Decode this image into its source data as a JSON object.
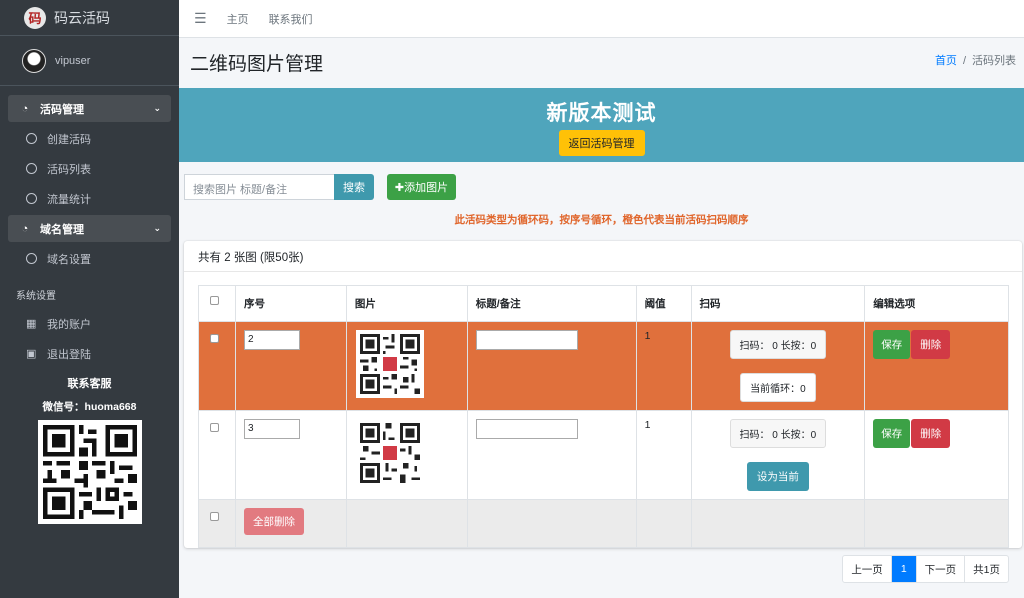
{
  "brand": {
    "logo_text": "码",
    "name": "码云活码"
  },
  "user": {
    "name": "vipuser"
  },
  "sidebar": {
    "groups": [
      {
        "label": "活码管理",
        "items": [
          "创建活码",
          "活码列表",
          "流量统计"
        ]
      },
      {
        "label": "域名管理",
        "items": [
          "域名设置"
        ]
      }
    ],
    "settings_header": "系统设置",
    "settings_items": [
      "我的账户",
      "退出登陆"
    ],
    "contact_title": "联系客服",
    "contact_wechat": "微信号：huoma668"
  },
  "topnav": {
    "items": [
      "主页",
      "联系我们"
    ]
  },
  "header": {
    "title": "二维码图片管理",
    "breadcrumb_home": "首页",
    "breadcrumb_sep": "/",
    "breadcrumb_current": "活码列表"
  },
  "banner": {
    "title": "新版本测试",
    "back_button": "返回活码管理",
    "color": "#4fa5bc"
  },
  "search": {
    "placeholder": "搜索图片 标题/备注",
    "button": "搜索",
    "add_button": "✚添加图片"
  },
  "notice": "此活码类型为循环码，按序号循环，橙色代表当前活码扫码顺序",
  "card": {
    "count_text": "共有 2 张图 (限50张)"
  },
  "table": {
    "headers": [
      "序号",
      "图片",
      "标题/备注",
      "阈值",
      "扫码",
      "编辑选项"
    ],
    "rows": [
      {
        "seq": "2",
        "title": "",
        "threshold": "1",
        "scan": "扫码： 0   长按：0",
        "loop": "当前循环：0",
        "save": "保存",
        "delete": "删除",
        "highlight": true
      },
      {
        "seq": "3",
        "title": "",
        "threshold": "1",
        "scan": "扫码： 0   长按：0",
        "set_current": "设为当前",
        "save": "保存",
        "delete": "删除",
        "highlight": false
      }
    ],
    "delete_all": "全部删除",
    "highlight_color": "#e0703c"
  },
  "pagination": {
    "prev": "上一页",
    "current": "1",
    "next": "下一页",
    "total": "共1页"
  }
}
